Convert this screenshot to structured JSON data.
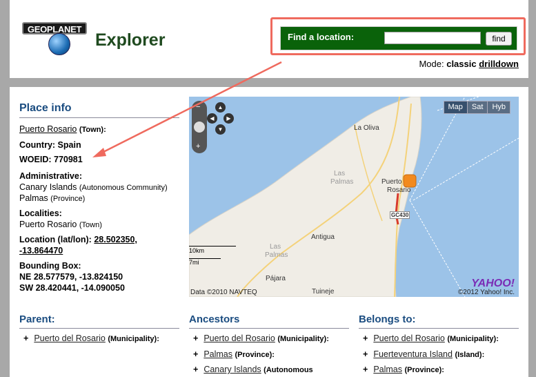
{
  "header": {
    "logo_text": "GEOPLANET",
    "title": "Explorer",
    "search": {
      "label": "Find a location:",
      "value": "",
      "button": "find"
    },
    "mode": {
      "prefix": "Mode:",
      "current": "classic",
      "alt": "drilldown"
    }
  },
  "place_info": {
    "title": "Place info",
    "name": "Puerto Rosario",
    "name_type": "(Town):",
    "country": "Country: Spain",
    "woeid": "WOEID: 770981",
    "admin_label": "Administrative:",
    "admin1": "Canary Islands",
    "admin1_type": "(Autonomous Community)",
    "admin2": "Palmas",
    "admin2_type": "(Province)",
    "localities_label": "Localities:",
    "locality": "Puerto Rosario",
    "locality_type": "(Town)",
    "location_label": "Location (lat/lon):",
    "location_value1": "28.502350,",
    "location_value2": "-13.864470",
    "bbox_label": "Bounding Box:",
    "bbox_ne": "NE 28.577579, -13.824150",
    "bbox_sw": "SW 28.420441, -14.090050"
  },
  "map": {
    "types": [
      "Map",
      "Sat",
      "Hyb"
    ],
    "labels": [
      "La Oliva",
      "Las",
      "Palmas",
      "Puerto",
      "Rosario",
      "Las",
      "Palmas",
      "Antigua",
      "Pájara",
      "Tuineje",
      "GC430"
    ],
    "scale": [
      "10km",
      "7mi"
    ],
    "brand": "YAHOO!",
    "copyright_left": "Data ©2010 NAVTEQ",
    "copyright_right": "©2012 Yahoo! Inc."
  },
  "columns": {
    "parent": {
      "title": "Parent:",
      "items": [
        {
          "name": "Puerto del Rosario",
          "type": "(Municipality):"
        }
      ]
    },
    "ancestors": {
      "title": "Ancestors",
      "items": [
        {
          "name": "Puerto del Rosario",
          "type": "(Municipality):"
        },
        {
          "name": "Palmas",
          "type": "(Province):"
        },
        {
          "name": "Canary Islands",
          "type": "(Autonomous"
        }
      ]
    },
    "belongs": {
      "title": "Belongs to:",
      "items": [
        {
          "name": "Puerto del Rosario",
          "type": "(Municipality):"
        },
        {
          "name": "Fuerteventura Island",
          "type": "(Island):"
        },
        {
          "name": "Palmas",
          "type": "(Province):"
        }
      ]
    }
  }
}
